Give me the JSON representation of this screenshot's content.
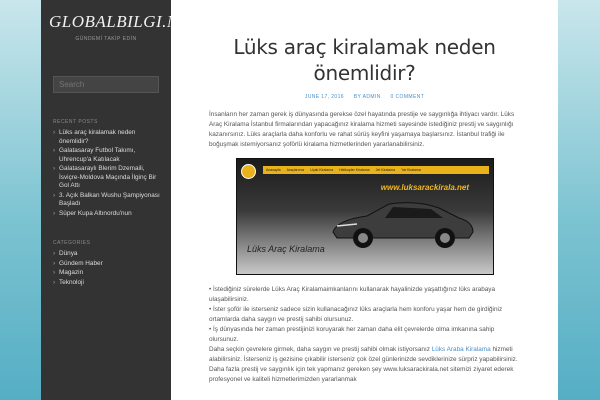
{
  "sidebar": {
    "site_title": "GLOBALBILGI.NET",
    "tagline": "GÜNDEMİ TAKİP EDİN",
    "search_placeholder": "Search",
    "recent_posts_title": "RECENT POSTS",
    "recent_posts": [
      "Lüks araç kiralamak neden önemlidir?",
      "Galatasaray Futbol Takımı, Uhrencup'a Katılacak",
      "Galatasaraylı Blerim Dzemaili, İsviçre-Moldova Maçında İlginç Bir Gol Attı",
      "3. Açık Balkan Wushu Şampiyonası Başladı",
      "Süper Kupa Altınordu'nun"
    ],
    "categories_title": "CATEGORIES",
    "categories": [
      "Dünya",
      "Gündem Haber",
      "Magazin",
      "Teknoloji"
    ]
  },
  "post": {
    "title": "Lüks araç kiralamak neden önemlidir?",
    "date": "JUNE 17, 2016",
    "author": "BY ADMIN",
    "comments": "0 COMMENT",
    "intro": "İnsanların her zaman gerek iş dünyasında gerekse özel hayatında prestije ve saygınlığa ihtiyacı vardır. Lüks Araç Kiralama İstanbul firmalarından yapacağınız kiralama hizmeti sayesinde istediğiniz prestij ve saygınlığı kazanırsınız. Lüks araçlarla daha konforlu ve rahat sürüş keyfini yaşamaya başlarsınız. İstanbul trafiği ile boğuşmak istemiyorsanız şoförlü kiralama hizmetlerinden yararlanabilirsiniz.",
    "image": {
      "menu_items": [
        "Anasayfa",
        "Araçlarımız",
        "Uçak Kiralama",
        "Helikopter Kiralama",
        "Jet Kiralama",
        "Yat Kiralama"
      ],
      "url_text": "www.luksarackirala.net",
      "caption": "Lüks Araç Kiralama"
    },
    "bullet_1": "• İstediğiniz sürelerde Lüks Araç Kiralamaimkanlarını kullanarak hayalinizde yaşattığınız lüks arabaya ulaşabilirsiniz.",
    "bullet_2": "• İster şoför ile isterseniz sadece sizin kullanacağınız lüks araçlarla hem konforu yaşar hem de girdiğiniz ortamlarda daha saygın ve prestij sahibi olursunuz.",
    "bullet_3": "• İş dünyasında her zaman prestijinizi koruyarak her zaman daha elit çevrelerde olma imkanına sahip olursunuz.",
    "para2_before": "Daha seçkin çevrelere girmek, daha saygın ve prestij sahibi olmak istiyorsanız ",
    "para2_link": "Lüks Araba Kiralama",
    "para2_after": " hizmeti alabilirsiniz. İsterseniz iş gezisine çıkabilir isterseniz çok özel günlerinizde sevdiklerinize sürpriz yapabilirsiniz. Daha fazla prestij ve saygınlık için tek yapmanız gereken şey www.luksarackirala.net sitemizi ziyaret ederek profesyonel ve kaliteli hizmetlerimizden yararlanmak"
  },
  "colors": {
    "accent": "#4a90c9",
    "sidebar_bg": "#333333",
    "banner_yellow": "#e9b21a"
  }
}
